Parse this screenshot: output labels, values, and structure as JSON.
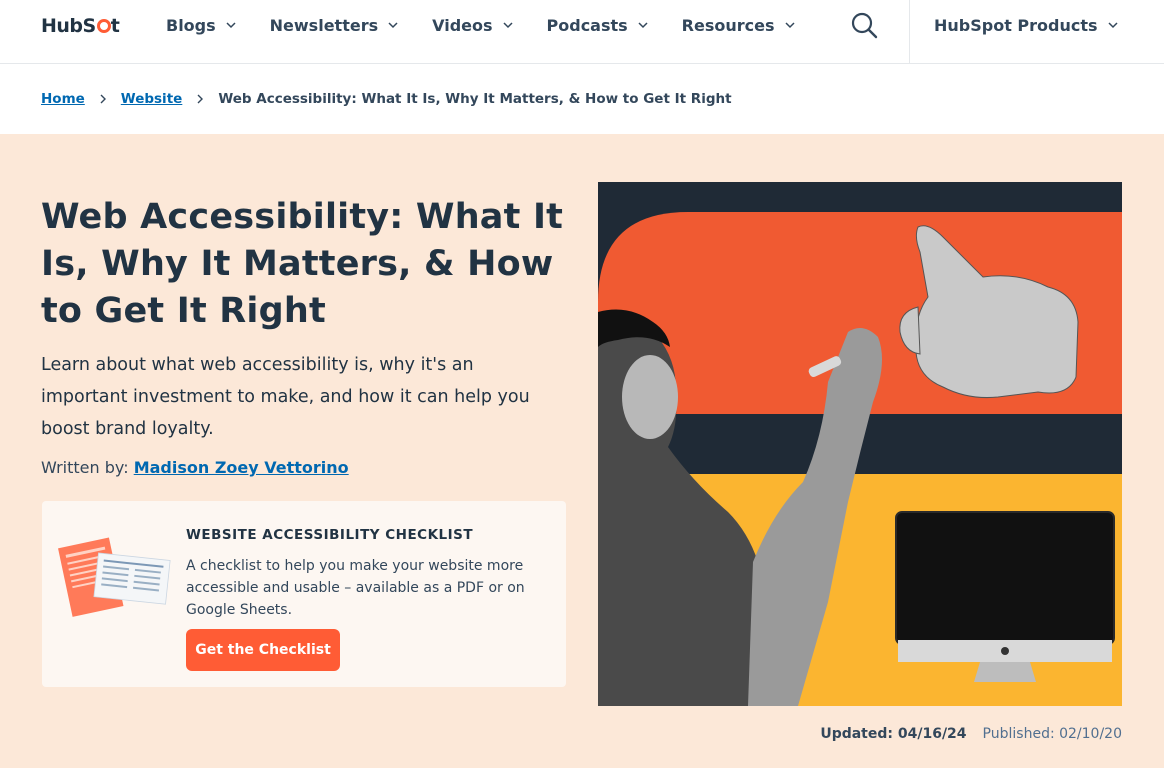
{
  "brand": {
    "logo_text_a": "HubS",
    "logo_text_b": "t",
    "accent": "#ff5c35",
    "link_color": "#0068b1",
    "hero_bg": "#fce8d8"
  },
  "nav": {
    "items": [
      {
        "label": "Blogs"
      },
      {
        "label": "Newsletters"
      },
      {
        "label": "Videos"
      },
      {
        "label": "Podcasts"
      },
      {
        "label": "Resources"
      }
    ],
    "search_icon": "search-icon",
    "products_label": "HubSpot Products"
  },
  "breadcrumb": {
    "home": "Home",
    "section": "Website",
    "current": "Web Accessibility: What It Is, Why It Matters, & How to Get It Right"
  },
  "article": {
    "title": "Web Accessibility: What It Is, Why It Matters, & How to Get It Right",
    "subtitle": "Learn about what web accessibility is, why it's an important investment to make, and how it can help you boost brand loyalty.",
    "byline_prefix": "Written by:",
    "author": "Madison Zoey Vettorino"
  },
  "cta": {
    "heading": "WEBSITE ACCESSIBILITY CHECKLIST",
    "description": "A checklist to help you make your website more accessible and usable – available as a PDF or on Google Sheets.",
    "button": "Get the Checklist"
  },
  "dates": {
    "updated": "Updated: 04/16/24",
    "published": "Published: 02/10/20"
  }
}
